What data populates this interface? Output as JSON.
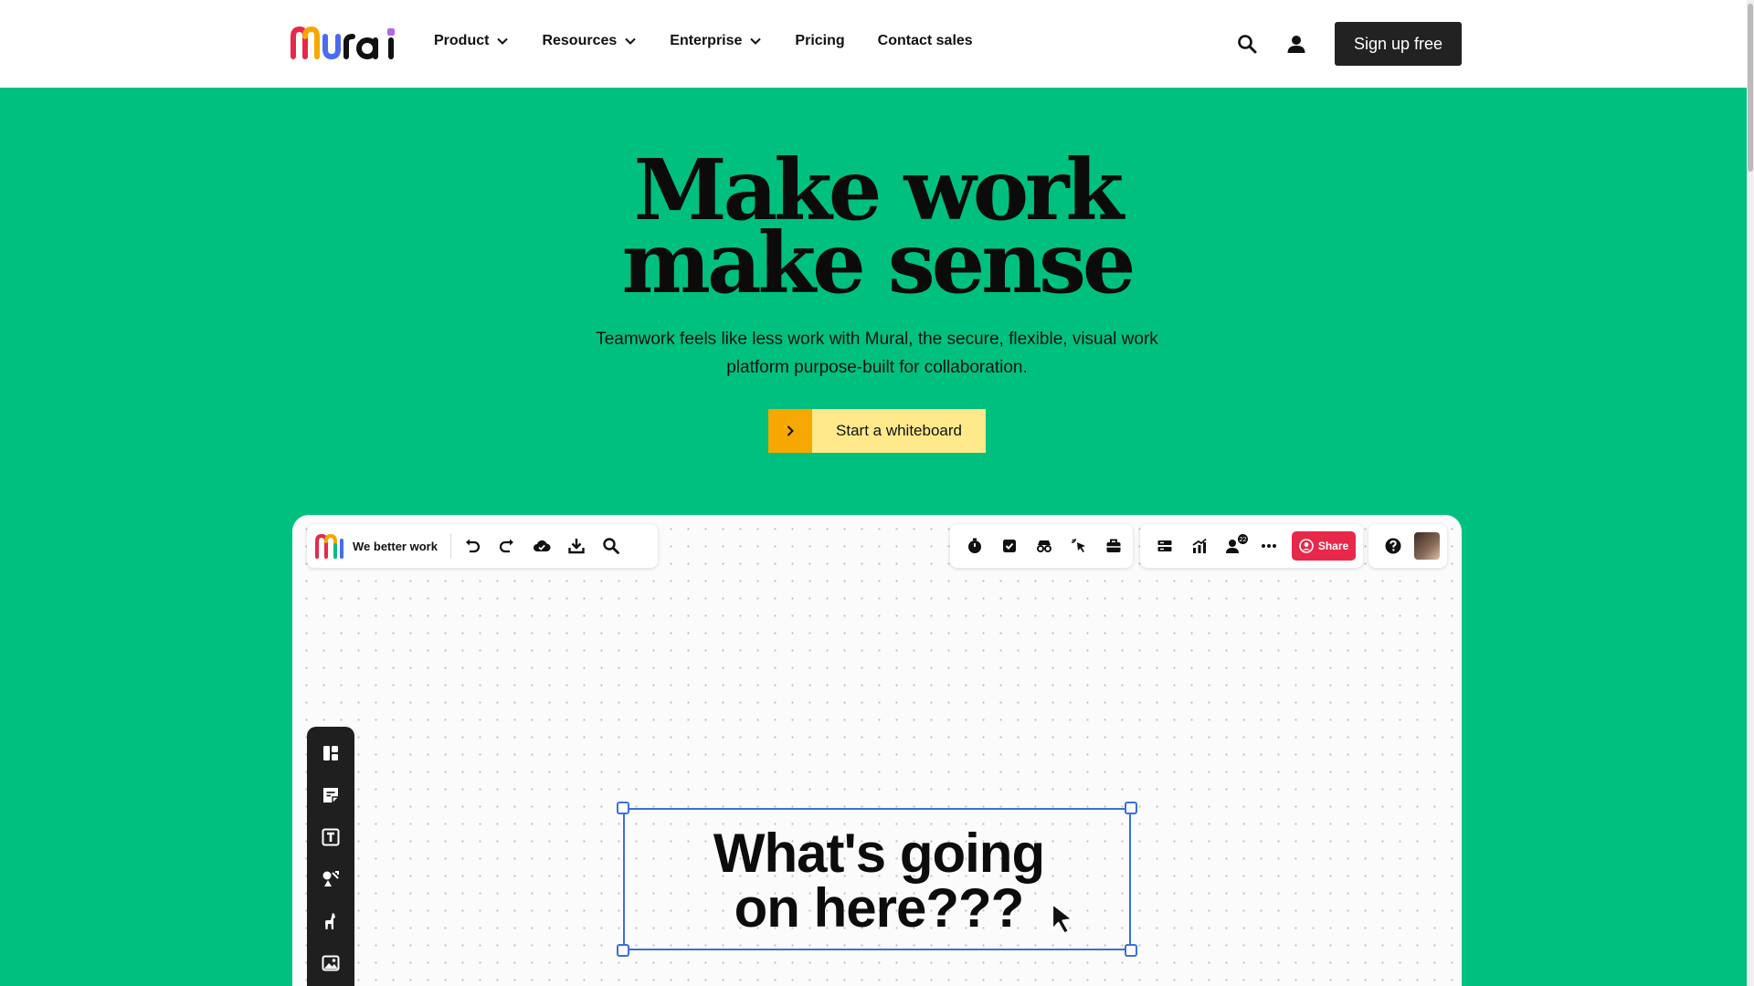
{
  "header": {
    "logo_text": "Mural",
    "nav": [
      {
        "label": "Product",
        "has_dropdown": true
      },
      {
        "label": "Resources",
        "has_dropdown": true
      },
      {
        "label": "Enterprise",
        "has_dropdown": true
      },
      {
        "label": "Pricing",
        "has_dropdown": false
      },
      {
        "label": "Contact sales",
        "has_dropdown": false
      }
    ],
    "icons": [
      "search-icon",
      "user-icon"
    ],
    "signup_label": "Sign up free"
  },
  "hero": {
    "title_line1": "Make work",
    "title_line2": "make sense",
    "subtitle_line1": "Teamwork feels like less work with Mural, the secure, flexible, visual work",
    "subtitle_line2": "platform purpose-built for collaboration.",
    "cta_label": "Start a whiteboard"
  },
  "board": {
    "name": "We better work",
    "left_toolbar_icons": [
      "undo-icon",
      "redo-icon",
      "cloud-saved-icon",
      "download-icon",
      "search-icon"
    ],
    "mid_toolbar_icons": [
      "timer-icon",
      "checkbox-icon",
      "private-mode-icon",
      "pointer-icon",
      "toolbox-icon"
    ],
    "right_toolbar_icons": [
      "outline-icon",
      "chart-icon",
      "collaborators-icon",
      "more-icon"
    ],
    "collaborators_count": "22",
    "share_label": "Share",
    "help_icon": "help-icon",
    "sidebar_icons": [
      "templates-icon",
      "sticky-note-icon",
      "text-icon",
      "shapes-icon",
      "icons-llama-icon",
      "image-icon"
    ],
    "canvas_text_line1": "What's going",
    "canvas_text_line2": "on here???"
  },
  "colors": {
    "hero_bg": "#00c07f",
    "cta_arrow": "#f7a800",
    "cta_label_bg": "#ffe98a",
    "share": "#e8284a",
    "selection": "#3c6fdc",
    "signup_bg": "#222222"
  }
}
